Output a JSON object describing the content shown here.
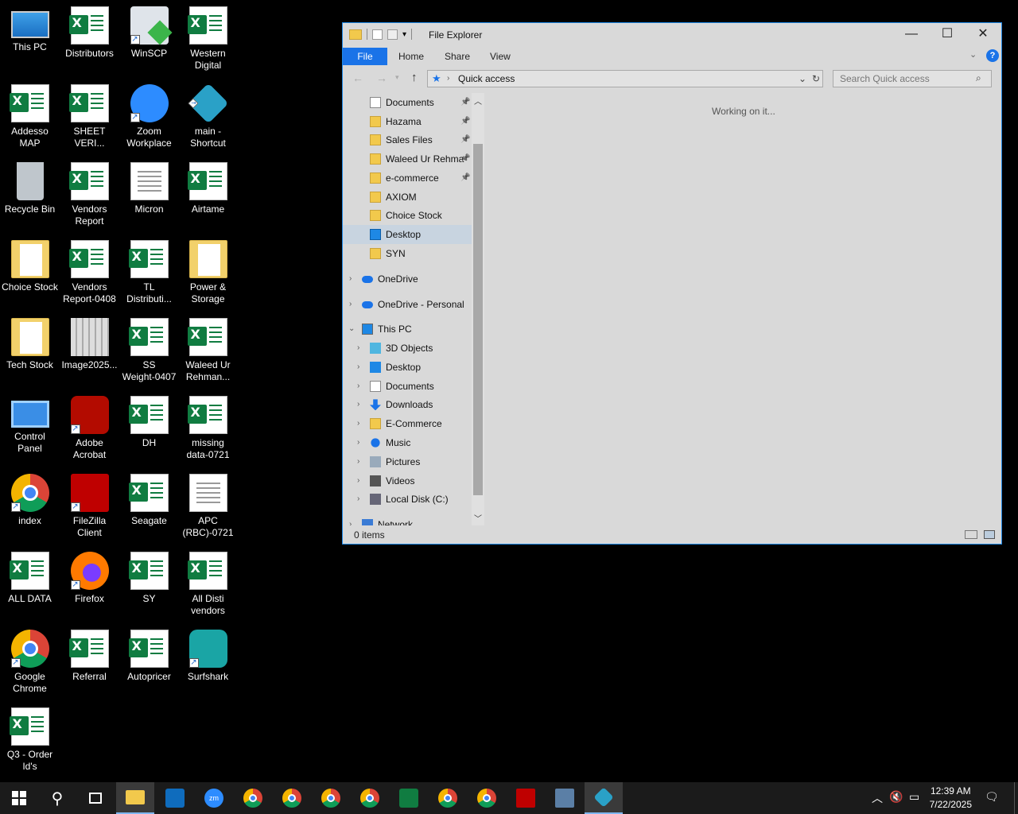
{
  "desktop": {
    "icons": [
      {
        "label": "This PC",
        "kind": "pc"
      },
      {
        "label": "Distributors",
        "kind": "excel"
      },
      {
        "label": "WinSCP",
        "kind": "winscp"
      },
      {
        "label": "Western\nDigital",
        "kind": "excel"
      },
      {
        "label": "Addesso\nMAP",
        "kind": "excel"
      },
      {
        "label": "SHEET\nVERI...",
        "kind": "excel"
      },
      {
        "label": "Zoom\nWorkplace",
        "kind": "zoom"
      },
      {
        "label": "main -\nShortcut",
        "kind": "main"
      },
      {
        "label": "Recycle Bin",
        "kind": "bin"
      },
      {
        "label": "Vendors\nReport",
        "kind": "excel"
      },
      {
        "label": "Micron",
        "kind": "doc"
      },
      {
        "label": "Airtame",
        "kind": "excel"
      },
      {
        "label": "Choice Stock",
        "kind": "folder"
      },
      {
        "label": "Vendors\nReport-0408",
        "kind": "excel"
      },
      {
        "label": "TL\nDistributi...",
        "kind": "excel"
      },
      {
        "label": "Power &\nStorage",
        "kind": "folder"
      },
      {
        "label": "Tech Stock",
        "kind": "folder"
      },
      {
        "label": "Image2025...",
        "kind": "image"
      },
      {
        "label": "SS\nWeight-0407",
        "kind": "excel"
      },
      {
        "label": "Waleed Ur\nRehman...",
        "kind": "excel"
      },
      {
        "label": "Control\nPanel",
        "kind": "control"
      },
      {
        "label": "Adobe\nAcrobat",
        "kind": "acrobat"
      },
      {
        "label": "DH",
        "kind": "excel"
      },
      {
        "label": "missing\ndata-0721",
        "kind": "excel"
      },
      {
        "label": "index",
        "kind": "chrome"
      },
      {
        "label": "FileZilla\nClient",
        "kind": "filezilla"
      },
      {
        "label": "Seagate",
        "kind": "excel"
      },
      {
        "label": "APC\n(RBC)-0721",
        "kind": "doc"
      },
      {
        "label": "ALL DATA",
        "kind": "excel"
      },
      {
        "label": "Firefox",
        "kind": "firefox"
      },
      {
        "label": "SY",
        "kind": "excel"
      },
      {
        "label": "All Disti\nvendors",
        "kind": "excel"
      },
      {
        "label": "Google\nChrome",
        "kind": "chrome"
      },
      {
        "label": "Referral",
        "kind": "excel"
      },
      {
        "label": "Autopricer",
        "kind": "excel"
      },
      {
        "label": "Surfshark",
        "kind": "surfshark"
      },
      {
        "label": "Q3 - Order\nId's",
        "kind": "excel"
      }
    ]
  },
  "explorer": {
    "title": "File Explorer",
    "tabs": {
      "file": "File",
      "home": "Home",
      "share": "Share",
      "view": "View"
    },
    "address": "Quick access",
    "search_placeholder": "Search Quick access",
    "working": "Working on it...",
    "status": "0 items",
    "quick_access": [
      "Documents",
      "Hazama",
      "Sales Files",
      "Waleed Ur Rehma",
      "e-commerce",
      "AXIOM",
      "Choice Stock",
      "Desktop",
      "SYN"
    ],
    "onedrive": "OneDrive",
    "onedrive_personal": "OneDrive - Personal",
    "this_pc": "This PC",
    "this_pc_items": [
      "3D Objects",
      "Desktop",
      "Documents",
      "Downloads",
      "E-Commerce",
      "Music",
      "Pictures",
      "Videos",
      "Local Disk (C:)"
    ],
    "network": "Network"
  },
  "taskbar": {
    "time": "12:39 AM",
    "date": "7/22/2025",
    "zoom_label": "zm"
  }
}
